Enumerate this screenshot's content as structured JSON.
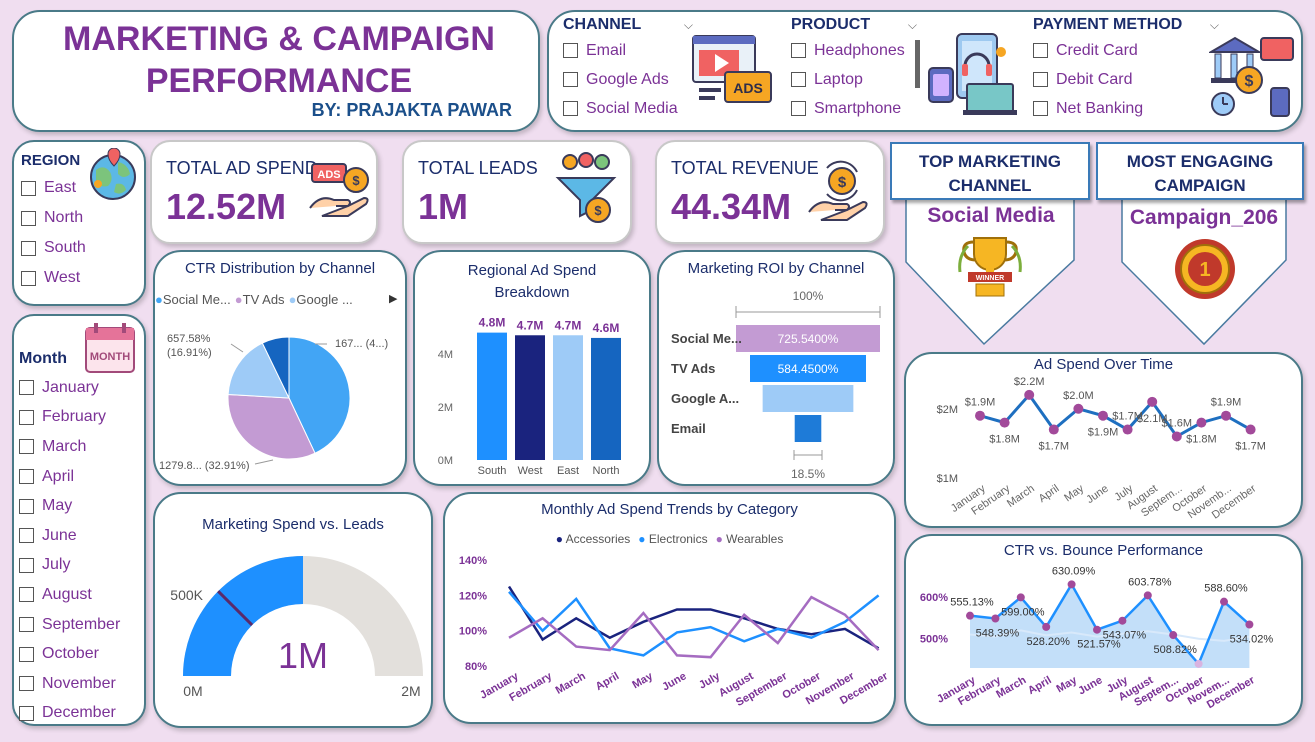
{
  "header": {
    "title_line1": "MARKETING & CAMPAIGN",
    "title_line2": "PERFORMANCE",
    "author": "BY: PRAJAKTA PAWAR"
  },
  "filters": {
    "channel": {
      "label": "CHANNEL",
      "icon": "ads-icon",
      "options": [
        "Email",
        "Google Ads",
        "Social Media"
      ]
    },
    "product": {
      "label": "PRODUCT",
      "icon": "devices-icon",
      "options": [
        "Headphones",
        "Laptop",
        "Smartphone"
      ]
    },
    "payment": {
      "label": "PAYMENT METHOD",
      "icon": "bank-payment-icon",
      "options": [
        "Credit Card",
        "Debit Card",
        "Net Banking"
      ]
    },
    "region": {
      "label": "REGION",
      "icon": "globe-icon",
      "options": [
        "East",
        "North",
        "South",
        "West"
      ]
    },
    "month": {
      "label": "Month",
      "icon": "calendar-icon",
      "icon_text": "MONTH",
      "options": [
        "January",
        "February",
        "March",
        "April",
        "May",
        "June",
        "July",
        "August",
        "September",
        "October",
        "November",
        "December"
      ]
    }
  },
  "kpis": {
    "ad_spend": {
      "label": "TOTAL AD SPEND",
      "value": "12.52M",
      "icon": "ads-hand-icon",
      "icon_text": "ADS"
    },
    "leads": {
      "label": "TOTAL LEADS",
      "value": "1M",
      "icon": "funnel-people-icon"
    },
    "revenue": {
      "label": "TOTAL REVENUE",
      "value": "44.34M",
      "icon": "revenue-hand-icon"
    }
  },
  "badges": {
    "top_channel": {
      "title_line1": "TOP MARKETING",
      "title_line2": "CHANNEL",
      "value": "Social Media",
      "icon": "trophy-icon",
      "icon_text": "WINNER"
    },
    "top_campaign": {
      "title_line1": "MOST ENGAGING",
      "title_line2": "CAMPAIGN",
      "value": "Campaign_206",
      "icon": "medal-icon",
      "icon_text": "1"
    }
  },
  "colors": {
    "purple": "#7b3296",
    "navy": "#1b2d6b",
    "blue": "#1e90ff",
    "dark_navy": "#1a237e",
    "light_blue": "#9ecbf7",
    "lavender": "#c39bd3",
    "mid_blue": "#1565c0"
  },
  "chart_data": [
    {
      "id": "ctr_pie",
      "type": "pie",
      "title": "CTR Distribution by Channel",
      "legend": [
        "Social Me...",
        "TV Ads",
        "Google ..."
      ],
      "labels": [
        "167... (4...)",
        "1279.8... (32.91%)",
        "657.58% (16.91%)"
      ],
      "slices": [
        {
          "name": "Social Media",
          "share": 0.43,
          "color": "#42a5f5"
        },
        {
          "name": "TV Ads",
          "share": 0.3291,
          "color": "#c39bd3"
        },
        {
          "name": "Google Ads",
          "share": 0.1691,
          "color": "#9ecbf7"
        },
        {
          "name": "Email",
          "share": 0.0718,
          "color": "#1565c0"
        }
      ]
    },
    {
      "id": "region_bar",
      "type": "bar",
      "title_line1": "Regional Ad Spend",
      "title_line2": "Breakdown",
      "categories": [
        "South",
        "West",
        "East",
        "North"
      ],
      "values": [
        4.8,
        4.7,
        4.7,
        4.6
      ],
      "data_labels": [
        "4.8M",
        "4.7M",
        "4.7M",
        "4.6M"
      ],
      "colors": [
        "#1e90ff",
        "#1a237e",
        "#9ecbf7",
        "#1565c0"
      ],
      "yticks": [
        "0M",
        "2M",
        "4M"
      ],
      "ylim": [
        0,
        5.2
      ]
    },
    {
      "id": "roi_funnel",
      "type": "bar",
      "title": "Marketing ROI by Channel",
      "categories": [
        "Social Me...",
        "TV Ads",
        "Google A...",
        "Email"
      ],
      "values": [
        725.54,
        584.45,
        457,
        134
      ],
      "data_labels": [
        "725.5400%",
        "584.4500%",
        "",
        ""
      ],
      "colors": [
        "#c39bd3",
        "#1e90ff",
        "#9ecbf7",
        "#1e7bd8"
      ],
      "top_label": "100%",
      "bottom_label": "18.5%"
    },
    {
      "id": "adspend_time",
      "type": "line",
      "title": "Ad Spend Over Time",
      "categories": [
        "January",
        "February",
        "March",
        "April",
        "May",
        "June",
        "July",
        "August",
        "Septem...",
        "October",
        "Novemb...",
        "December"
      ],
      "values": [
        1.9,
        1.8,
        2.2,
        1.7,
        2.0,
        1.9,
        1.7,
        2.1,
        1.6,
        1.8,
        1.9,
        1.7
      ],
      "data_labels": [
        "$1.9M",
        "$1.8M",
        "$2.2M",
        "$1.7M",
        "$2.0M",
        "$1.9M",
        "$1.7M",
        "$2.1M",
        "$1.6M",
        "$1.8M",
        "$1.9M",
        "$1.7M"
      ],
      "yticks": [
        "$1M",
        "$2M"
      ],
      "ylim": [
        1.0,
        2.3
      ]
    },
    {
      "id": "gauge",
      "type": "gauge",
      "title": "Marketing Spend vs. Leads",
      "value": 1.0,
      "max": 2.0,
      "target": 0.5,
      "value_label": "1M",
      "min_label": "0M",
      "max_label": "2M",
      "target_label": "500K"
    },
    {
      "id": "monthly_trends",
      "type": "line",
      "title": "Monthly Ad Spend Trends by Category",
      "categories": [
        "January",
        "February",
        "March",
        "April",
        "May",
        "June",
        "July",
        "August",
        "September",
        "October",
        "November",
        "December"
      ],
      "yticks": [
        "80%",
        "100%",
        "120%",
        "140%"
      ],
      "ylim": [
        80,
        145
      ],
      "series": [
        {
          "name": "Accessories",
          "color": "#1a237e",
          "values": [
            125,
            95,
            107,
            96,
            105,
            112,
            112,
            107,
            101,
            98,
            101,
            90
          ]
        },
        {
          "name": "Electronics",
          "color": "#1e90ff",
          "values": [
            122,
            100,
            118,
            90,
            86,
            99,
            102,
            94,
            101,
            96,
            105,
            120
          ]
        },
        {
          "name": "Wearables",
          "color": "#a56cc1",
          "values": [
            96,
            107,
            91,
            89,
            110,
            86,
            85,
            109,
            93,
            119,
            109,
            89
          ]
        }
      ]
    },
    {
      "id": "ctr_bounce",
      "type": "area",
      "title": "CTR vs. Bounce Performance",
      "categories": [
        "January",
        "February",
        "March",
        "April",
        "May",
        "June",
        "July",
        "August",
        "Septem...",
        "October",
        "Novem...",
        "December"
      ],
      "ctr": [
        555.13,
        548.39,
        599.0,
        528.2,
        630.09,
        521.57,
        543.07,
        603.78,
        508.82,
        440,
        588.6,
        534.02
      ],
      "bounce": [
        510,
        505,
        520,
        508,
        515,
        505,
        512,
        518,
        510,
        500,
        495,
        505
      ],
      "data_labels": [
        "555.13%",
        "548.39%",
        "599.00%",
        "528.20%",
        "630.09%",
        "521.57%",
        "543.07%",
        "603.78%",
        "508.82%",
        "",
        "588.60%",
        "534.02%"
      ],
      "yticks": [
        "500%",
        "600%"
      ],
      "ylim": [
        430,
        650
      ]
    }
  ]
}
